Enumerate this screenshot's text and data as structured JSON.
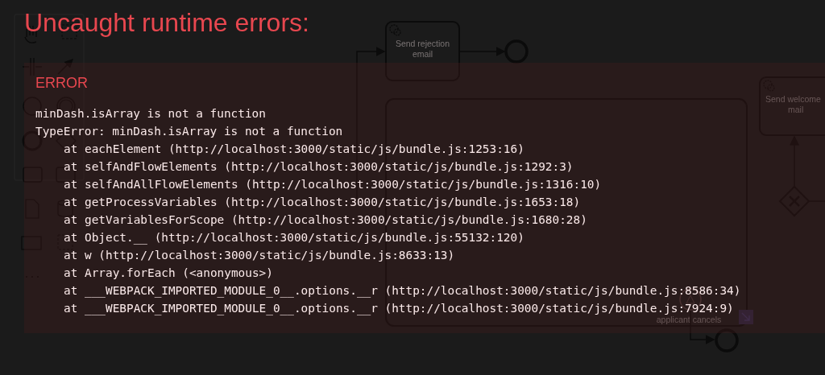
{
  "diagram": {
    "tasks": [
      {
        "lines": [
          "Send rejection",
          "email"
        ]
      },
      {
        "lines": [
          "Send welcome",
          "mail"
        ]
      }
    ],
    "event_label": "applicant cancels"
  },
  "overlay": {
    "title": "Uncaught runtime errors:",
    "error": {
      "label": "ERROR",
      "lines": [
        {
          "kind": "message",
          "text": "minDash.isArray is not a function"
        },
        {
          "kind": "message",
          "text": "TypeError: minDash.isArray is not a function"
        },
        {
          "kind": "frame",
          "text": "at eachElement (http://localhost:3000/static/js/bundle.js:1253:16)"
        },
        {
          "kind": "frame",
          "text": "at selfAndFlowElements (http://localhost:3000/static/js/bundle.js:1292:3)"
        },
        {
          "kind": "frame",
          "text": "at selfAndAllFlowElements (http://localhost:3000/static/js/bundle.js:1316:10)"
        },
        {
          "kind": "frame",
          "text": "at getProcessVariables (http://localhost:3000/static/js/bundle.js:1653:18)"
        },
        {
          "kind": "frame",
          "text": "at getVariablesForScope (http://localhost:3000/static/js/bundle.js:1680:28)"
        },
        {
          "kind": "frame",
          "text": "at Object.__ (http://localhost:3000/static/js/bundle.js:55132:120)"
        },
        {
          "kind": "frame",
          "text": "at w (http://localhost:3000/static/js/bundle.js:8633:13)"
        },
        {
          "kind": "frame",
          "text": "at Array.forEach (<anonymous>)"
        },
        {
          "kind": "frame",
          "text": "at ___WEBPACK_IMPORTED_MODULE_0__.options.__r (http://localhost:3000/static/js/bundle.js:8586:34)"
        },
        {
          "kind": "frame",
          "text": "at ___WEBPACK_IMPORTED_MODULE_0__.options.__r (http://localhost:3000/static/js/bundle.js:7924:9)"
        }
      ]
    }
  }
}
